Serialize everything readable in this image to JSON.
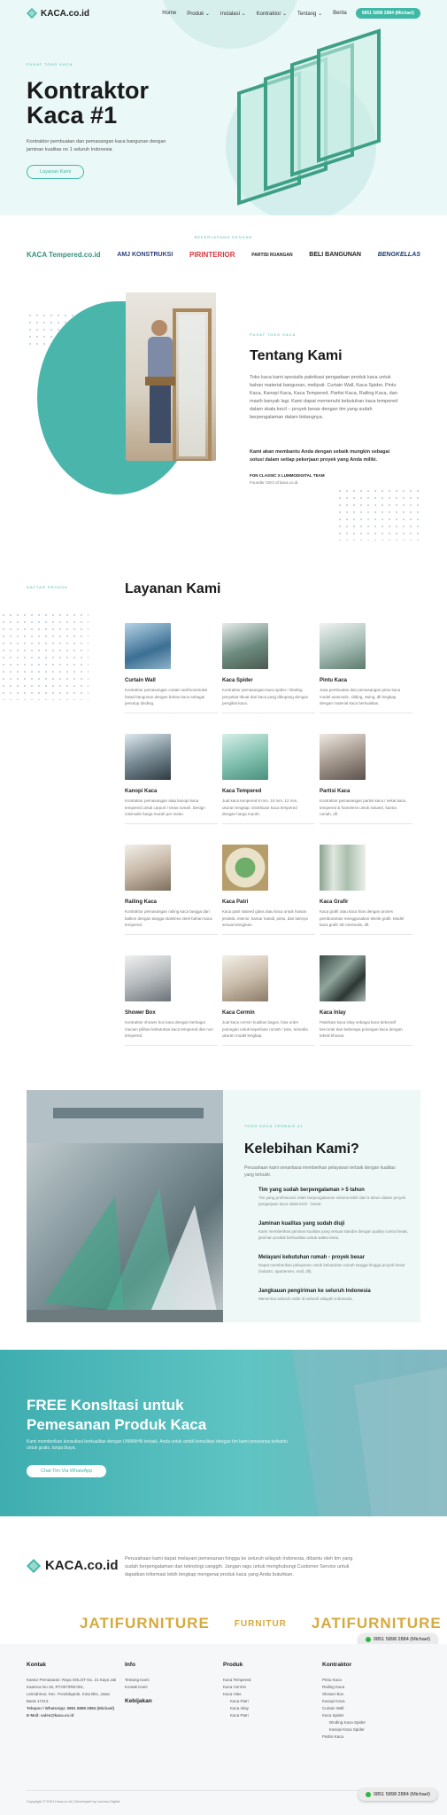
{
  "header": {
    "logo_text": "KACA.co.id",
    "nav": [
      "Home",
      "Produk",
      "Instalasi",
      "Kontraktor",
      "Tentang",
      "Berita"
    ],
    "cta": "0851 5898 2884 (Michael)"
  },
  "hero": {
    "tag": "PUSAT TOKO KACA",
    "title": "Kontraktor Kaca #1",
    "subtitle": "Kontraktor pembuatan dan pemasangan kaca bangunan dengan jaminan kualitas no 1 seluruh Indonesia",
    "button": "Layanan Kami"
  },
  "partners": {
    "tag": "BEKERJASAMA DENGAN",
    "logos": [
      "KACA Tempered.co.id",
      "AMJ KONSTRUKSI",
      "PIRINTERIOR",
      "PARTISI RUANGAN",
      "BELI BANGUNAN",
      "BENGKELLAS"
    ]
  },
  "about": {
    "tag": "PUSAT TOKO KACA",
    "title": "Tentang Kami",
    "paragraph": "Toko kaca kami spesialis pabrikasi pengadaan produk kaca untuk bahan material bangunan, meliputi: Curtain Wall, Kaca Spider, Pintu Kaca, Kanopi Kaca, Kaca Tempered, Partisi Kaca, Railing Kaca, dan masih banyak lagi. Kami dapat memenuhi kebutuhan kaca tempered dalam skala kecil – proyek besar dengan tim yang sudah berpengalaman dalam bidangnya.",
    "bold": "Kami akan membantu Anda dengan sebaik mungkin sebagai solusi dalam setiap pekerjaan proyek yang Anda miliki.",
    "signature": "FON CLASSIC X LUMMODIGITAL TEAM",
    "signature_role": "Founder CEO of kaca.co.id"
  },
  "services": {
    "tag": "DAFTAR PRODUK",
    "title": "Layanan Kami",
    "items": [
      {
        "title": "Curtain Wall",
        "desc": "Kontraktor pemasangan curtain wall konstruksi fasad bangunan dengan bahan kaca sebagai penutup dinding."
      },
      {
        "title": "Kaca Spider",
        "desc": "Kontraktor pemasangan kaca spider / dinding penyekat tibuat dari kaca yang dibopang dengan pengikat kaca."
      },
      {
        "title": "Pintu Kaca",
        "desc": "Jasa pembuatan dan pemasangan pintu kaca model automatic, sliding, swing, dll lengkap dengan material kaca berkualitas."
      },
      {
        "title": "Kanopi Kaca",
        "desc": "Kontraktor pemasangan atap kanopi kaca tempered untuk carport / teras rumah. Design minimalis harga murah per meter."
      },
      {
        "title": "Kaca Tempered",
        "desc": "Jual kaca tempered 8 mm, 10 mm, 12 mm, ukuran lengkap. Distributor kaca tempered dengan harga murah."
      },
      {
        "title": "Partisi Kaca",
        "desc": "Kontraktor pemasangan partisi kaca / sekat kaca tempered & frameless untuk industri, kantor, rumah, dll."
      },
      {
        "title": "Railing Kaca",
        "desc": "Kontraktor pemasangan railing kaca tangga dan balkon dengan tangga stainless steel bahan kaca tempered."
      },
      {
        "title": "Kaca Patri",
        "desc": "Kaca patri stained glass atau kaca untuk hiasan jendela, interior, kamar mandi, pintu, dan lainnya sesuai keinginan."
      },
      {
        "title": "Kaca Grafir",
        "desc": "Kaca grafir atau kaca hias dengan proses pemburaman menggunakan teknik grafir. Model kaca grafir 3D minimalis, dll."
      },
      {
        "title": "Shower Box",
        "desc": "Kontraktor shower box kaca dengan berbagai macam pilihan kebutuhan kaca tempered dan non tempered."
      },
      {
        "title": "Kaca Cermin",
        "desc": "Jual kaca cermin kualitas bagus, bisa order potongan untuk keperluan rumah / toko, tersedia ukuran model lengkap."
      },
      {
        "title": "Kaca Inlay",
        "desc": "Pabrikasi kaca inlay sebagai kaca dekoratif bercorak dan beberapa potongan kaca dengan teknik khusus."
      }
    ]
  },
  "advantages": {
    "tag": "TOKO KACA TERBAIK #1",
    "title": "Kelebihan Kami?",
    "subtitle": "Perusahaan kami senantiasa memberikan pelayanan terbaik dengan kualitas yang terbukti.",
    "items": [
      {
        "title": "Tim yang sudah berpengalaman > 5 tahun",
        "desc": "Tim yang profesional, telah berpengalaman selama lebih dari 5 tahun dalam proyek pengerjaan kaca skala kecil - besar."
      },
      {
        "title": "Jaminan kualitas yang sudah diuji",
        "desc": "Kami memberikan jaminan kualitas yang sesuai standar dengan quality control ketat, jaminan produk berkualitas untuk waktu lama."
      },
      {
        "title": "Melayani kebutuhan rumah - proyek besar",
        "desc": "Dapat memberikan pelayanan untuk kebutuhan rumah tangga hingga proyek besar (industri, apartemen, mall, dll)."
      },
      {
        "title": "Jangkauan pengiriman ke seluruh Indonesia",
        "desc": "Menerima seluruh order di seluruh wilayah Indonesia."
      }
    ]
  },
  "cta": {
    "title": "FREE Konsltasi untuk Pemesanan Produk Kaca",
    "subtitle": "Kami memberikan konsultasi berkualitas dengan UNIBAHN terbaik, Anda untuk ambil konsultasi dengan tim kami prosesnya terbantu untuk gratis, tanpa biaya.",
    "button": "Chat Tim Via WhatsApp"
  },
  "footer_intro": {
    "logo_text": "KACA.co.id",
    "text": "Perusahaan kami dapat melayani pemesanan hingga ke seluruh wilayah Indonesia, dibantu oleh tim yang sudah berpengalaman dan teknologi canggih. Jangan ragu untuk menghubungi Customer Service untuk dapatkan informasi lebih lengkap mengenai produk kaca yang Anda butuhkan."
  },
  "brands": [
    "JATIFURNITURE",
    "FURNITUR",
    "JATIFURNITURE"
  ],
  "whatsapp": "0851 5898 2884 (Michael)",
  "footer": {
    "kontak": {
      "title": "Kontak",
      "lines": [
        "Kantor Pemasaran: Raya SOLOT No. 21 Kaya Jati Kaanrus No 26, RT.007/RW.001,",
        "Leimahmur, Kec. Pondokgede, Kota Bks, Jawa",
        "Barat 17413",
        "Telepon / WhatsApp: 0851 5898 2884 (Michael)",
        "E-Mail: sales@kaca.co.id"
      ]
    },
    "info": {
      "title": "Info",
      "items": [
        "Tentang Kami",
        "Kontak Kami",
        "Kebijakan"
      ]
    },
    "produk": {
      "title": "Produk",
      "items": [
        "Kaca Tempered",
        "Kaca Cermin",
        "Kaca Hias",
        "Kaca Patri",
        "Kaca Inlay",
        "Kaca Patri"
      ]
    },
    "kontraktor": {
      "title": "Kontraktor",
      "items": [
        "Pintu Kaca",
        "Railing Kaca",
        "Shower Box",
        "Kanopi Kaca",
        "Curtain Wall",
        "Kaca Spider",
        "Dinding Kaca Spider",
        "Kanopi Kaca Spider",
        "Partisi Kaca"
      ]
    },
    "copyright": "Copyright © 2021 Kaca.co.id | Developed by Lummo Digital"
  },
  "colors": {
    "accent": "#3fb8a6",
    "hero_bg": "#eaf8f7",
    "brand_gold": "#d6aa3c"
  }
}
